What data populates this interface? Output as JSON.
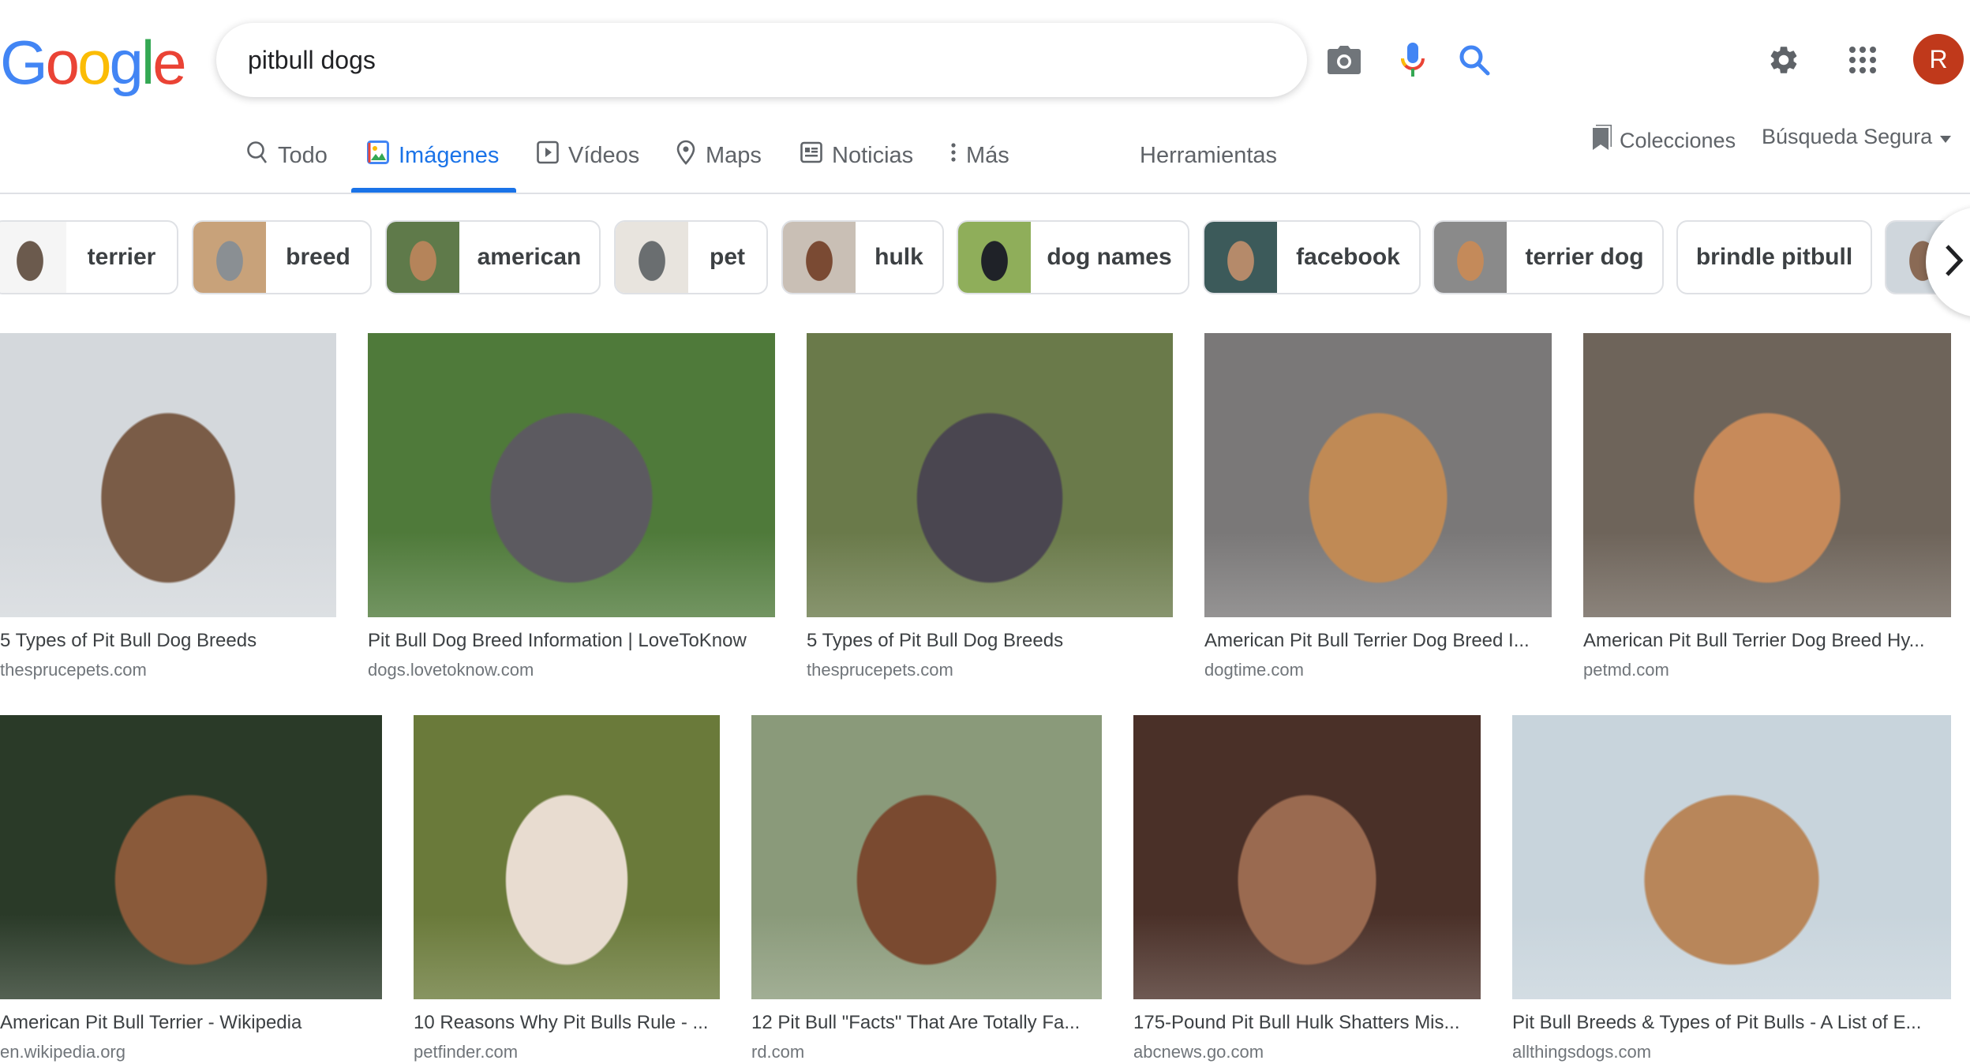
{
  "logo": {
    "letters": [
      "G",
      "o",
      "o",
      "g",
      "l",
      "e"
    ],
    "colors": [
      "#4285f4",
      "#ea4335",
      "#fbbc05",
      "#4285f4",
      "#34a853",
      "#ea4335"
    ]
  },
  "search": {
    "query": "pitbull dogs",
    "icons": [
      "camera-icon",
      "microphone-icon",
      "search-icon"
    ]
  },
  "header": {
    "avatar_letter": "R",
    "avatar_color": "#c0391b",
    "icons": [
      "gear-icon",
      "apps-grid-icon"
    ]
  },
  "tabs": [
    {
      "label": "Todo",
      "icon": "search-icon",
      "active": false
    },
    {
      "label": "Imágenes",
      "icon": "image-icon",
      "active": true
    },
    {
      "label": "Vídeos",
      "icon": "video-icon",
      "active": false
    },
    {
      "label": "Maps",
      "icon": "map-pin-icon",
      "active": false
    },
    {
      "label": "Noticias",
      "icon": "news-icon",
      "active": false
    },
    {
      "label": "Más",
      "icon": "more-vertical-icon",
      "active": false
    }
  ],
  "tools_label": "Herramientas",
  "collections_label": "Colecciones",
  "safesearch_label": "Búsqueda Segura",
  "accent_color": "#1a73e8",
  "chips": [
    {
      "label": "terrier",
      "thumb": [
        "#f5f5f5",
        "#6b5a4d"
      ]
    },
    {
      "label": "breed",
      "thumb": [
        "#c8a27a",
        "#8a8f93"
      ]
    },
    {
      "label": "american",
      "thumb": [
        "#5f7a4a",
        "#b5845a"
      ]
    },
    {
      "label": "pet",
      "thumb": [
        "#e8e4de",
        "#6a6e70"
      ]
    },
    {
      "label": "hulk",
      "thumb": [
        "#c9bfb5",
        "#7a4a33"
      ]
    },
    {
      "label": "dog names",
      "thumb": [
        "#8fae5a",
        "#1f2228"
      ]
    },
    {
      "label": "facebook",
      "thumb": [
        "#3c5a5a",
        "#b58a6a"
      ]
    },
    {
      "label": "terrier dog",
      "thumb": [
        "#8a8a8a",
        "#c48a5a"
      ]
    },
    {
      "label": "brindle pitbull",
      "thumb": null
    },
    {
      "label": "",
      "thumb": [
        "#cfd6dc",
        "#8a6a55"
      ]
    }
  ],
  "results": [
    {
      "title": "5 Types of Pit Bull Dog Breeds",
      "domain": "thesprucepets.com",
      "colors": [
        "#d4d8dc",
        "#7a5c47"
      ]
    },
    {
      "title": "Pit Bull Dog Breed Information | LoveToKnow",
      "domain": "dogs.lovetoknow.com",
      "colors": [
        "#4f7a3a",
        "#5c5a60"
      ]
    },
    {
      "title": "5 Types of Pit Bull Dog Breeds",
      "domain": "thesprucepets.com",
      "colors": [
        "#6a7a4a",
        "#4a4650"
      ]
    },
    {
      "title": "American Pit Bull Terrier Dog Breed I...",
      "domain": "dogtime.com",
      "colors": [
        "#7a7878",
        "#c08a55"
      ]
    },
    {
      "title": "American Pit Bull Terrier Dog Breed Hy...",
      "domain": "petmd.com",
      "colors": [
        "#6e645a",
        "#c78a5a"
      ]
    },
    {
      "title": "American Pit Bull Terrier - Wikipedia",
      "domain": "en.wikipedia.org",
      "colors": [
        "#2a3a28",
        "#8a5a3a"
      ]
    },
    {
      "title": "10 Reasons Why Pit Bulls Rule - ...",
      "domain": "petfinder.com",
      "colors": [
        "#6a7a3a",
        "#e8dcd0"
      ]
    },
    {
      "title": "12 Pit Bull \"Facts\" That Are Totally Fa...",
      "domain": "rd.com",
      "colors": [
        "#8a9a7a",
        "#7a4a30"
      ]
    },
    {
      "title": "175-Pound Pit Bull Hulk Shatters Mis...",
      "domain": "abcnews.go.com",
      "colors": [
        "#4a3028",
        "#9a6a50"
      ]
    },
    {
      "title": "Pit Bull Breeds & Types of Pit Bulls - A List of E...",
      "domain": "allthingsdogs.com",
      "colors": [
        "#c8d4dc",
        "#b8865a"
      ]
    }
  ]
}
